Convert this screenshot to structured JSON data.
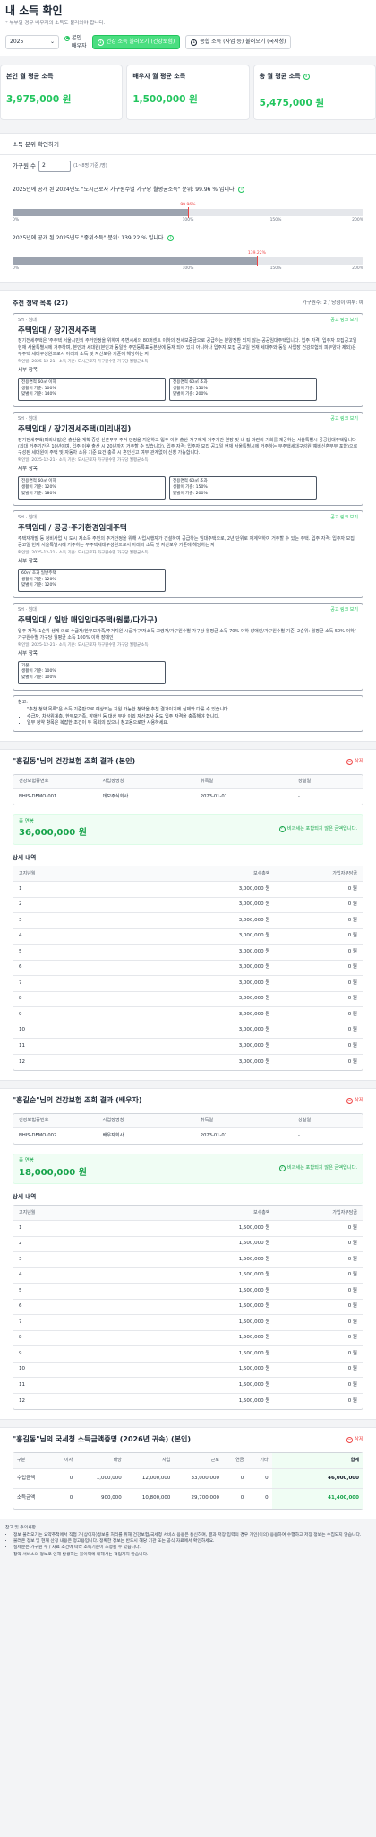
{
  "header": {
    "title": "내 소득 확인",
    "note": "* 부부일 경우 배우자의 소득도 불러와야 합니다.",
    "year_select": "2025",
    "radio_options": [
      "본인",
      "배우자"
    ],
    "btn_health": "건강 소득 불러오기 (건강보험)",
    "btn_tax": "종합 소득 (사업 등) 불러오기 (국세청)"
  },
  "summary": {
    "self_title": "본인 월 평균 소득",
    "self_value": "3,975,000 원",
    "spouse_title": "배우자 월 평균 소득",
    "spouse_value": "1,500,000 원",
    "total_title": "총 월 평균 소득",
    "total_value": "5,475,000 원"
  },
  "rank": {
    "section_title": "소득 분위 확인하기",
    "household_label": "가구원 수",
    "household_value": "2",
    "household_hint": "(1~8명 기준 /명)",
    "bar1_label": "2025년에 공개 된 2024년도 \"도시근로자 가구원수별 가구당 월평균소득\" 분위: 99.96 % 입니다.",
    "bar1_marker": "99.96%",
    "bar1_percent": 99.96,
    "bar2_label": "2025년에 공개 된 2025년도 \"중위소득\" 분위: 139.22 % 입니다.",
    "bar2_marker": "139.22%",
    "bar2_percent": 139.22,
    "ticks": [
      "0%",
      "100%",
      "150%",
      "200%"
    ]
  },
  "recommend": {
    "title": "추천 청약 목록 (27)",
    "meta": "가구원수: 2 / 당첨이 여부: 예",
    "link": "공고 링크 보기",
    "sub_label": "세부 항목",
    "items": [
      {
        "org": "SH · 임대",
        "name": "주택임대 / 장기전세주택",
        "desc": "장기전세주택은 '주주택 서울시민의 주거안정을 위하여 주변시세의 80퍼센트 이하의 전세보증금으로 공급하는 분양전환 되지 않는 공공임대주택입니다. 입주 자격: 입주자 모집공고일 현재 서울특별시에 거주하며, 본인과 세대원(본인과 동일한 주민등록표등본상에 등재 되어 있지 아니하나 입주자 모집 공고일 현재 세대주와 동일 사업장 건강보험의 피부양자 제외)은 무주택 세대구성원으로서 아래의 소득 및 자산보유 기준에 해당하는 자",
        "date": "확인일: 2025-12-21 · 소득 기준: 도시근로자 가구원수별 가구당 월평균소득",
        "criteria": [
          [
            "전용면적 60㎡ 이하",
            "생활이 기준: 100%",
            "맞벌이 기준: 140%"
          ],
          [
            "전용면적 60㎡ 초과",
            "생활이 기준: 150%",
            "맞벌이 기준: 200%"
          ]
        ]
      },
      {
        "org": "SH · 임대",
        "name": "주택임대 / 장기전세주택(미리내집)",
        "desc": "장기전세주택(미리내집)은 출산을 계획 중인 신혼부부 주거 안정을 지원하고 입주 이후 출산 가구에게 거주기간 연장 및 내 집 마련의 기회를 제공하는 서울특별시 공공임대주택입니다(최대 거주기간은 10년이며, 입주 이후 출산 시 20년까지 거주할 수 있습니다). 입주 자격: 입주자 모집 공고일 현재 서울특별시에 거주하는 무주택세대구성원(예비신혼부부 포함)으로 구성된 세대원이 주택 및 자동차 소유 기준 요건 충족 시 혼인신고 여부 관계없이 신청 가능합니다.",
        "date": "확인일: 2025-12-21 · 소득 기준: 도시근로자 가구원수별 가구당 월평균소득",
        "criteria": [
          [
            "전용면적 60㎡ 이하",
            "생활이 기준: 120%",
            "맞벌이 기준: 180%"
          ],
          [
            "전용면적 60㎡ 초과",
            "생활이 기준: 150%",
            "맞벌이 기준: 200%"
          ]
        ]
      },
      {
        "org": "SH · 임대",
        "name": "주택임대 / 공공·주거환경임대주택",
        "desc": "주택재개발 등 정비사업 시 도시 저소득 주민의 주거안정을 위해 사업시행자가 건설하여 공급하는 임대주택으로, 2년 단위로 재계약하여 거주할 수 있는 주택. 입주 자격: 입주자 모집공고일 현재 서울특별시에 거주하는 무주택세대구성원으로서 아래의 소득 및 자산보유 기준에 해당하는 자",
        "date": "확인일: 2025-12-21 · 소득 기준: 도시근로자 가구원수별 가구당 월평균소득",
        "criteria": [
          [
            "60㎡ 초과 일반주택",
            "생활이 기준: 120%",
            "맞벌이 기준: 120%"
          ]
        ]
      },
      {
        "org": "SH · 임대",
        "name": "주택임대 / 일반 매입임대주택(원룸/다가구)",
        "desc": "입주 자격: 1순위 생계·의료 수급자/한부모가족/주거지원 시급가구/저소득 고령자/가구원수별 가구당 월평균 소득 70% 이하 장애인/가구원수별 기준, 2순위: 월평균 소득 50% 이하/가구원수별 가구당 월평균 소득 100% 이하 장애인",
        "date": "확인일: 2025-12-21 · 소득 기준: 도시근로자 가구원수별 가구당 월평균소득",
        "criteria": [
          [
            "기본",
            "생활이 기준: 100%",
            "맞벌이 기준: 100%"
          ]
        ]
      }
    ],
    "note_title": "참고:",
    "notes": [
      "\"추천 청약 목록\"은 소득 기준만으로 예상되는 지원 가능한 청약을 추천 결과이기에 실제와 다를 수 있습니다.",
      "수급자, 차상위계층, 한부모가족, 장애인 등 대상 무관 이외 자산조사 등도 입주 자격을 충족해야 합니다.",
      "일부 청약 항목은 복잡한 조건이 두 목회의 있으니 청고용으로만 사용하세요."
    ]
  },
  "health": [
    {
      "title": "\"홍길동\"님의 건강보험 조회 결과 (본인)",
      "delete": "삭제",
      "headers": [
        "건강보험증번호",
        "사업장명칭",
        "취득일",
        "상실일"
      ],
      "row": [
        "NHIS-DEMO-001",
        "데모주식회사",
        "2023-01-01",
        "-"
      ],
      "total_label": "총 연봉",
      "total_value": "36,000,000 원",
      "badge": "비과세는 포함되지 않은 금액입니다.",
      "detail_title": "상세 내역",
      "col_month": "고지년월",
      "col_premium": "보수총액",
      "col_extra": "가입자부담금",
      "months": [
        "1",
        "2",
        "3",
        "4",
        "5",
        "6",
        "7",
        "8",
        "9",
        "10",
        "11",
        "12"
      ],
      "amount": "3,000,000 원",
      "extra": "0 원"
    },
    {
      "title": "\"홍길순\"님의 건강보험 조회 결과 (배우자)",
      "delete": "삭제",
      "headers": [
        "건강보험증번호",
        "사업장명칭",
        "취득일",
        "상실일"
      ],
      "row": [
        "NHIS-DEMO-002",
        "배우자회사",
        "2023-01-01",
        "-"
      ],
      "total_label": "총 연봉",
      "total_value": "18,000,000 원",
      "badge": "비과세는 포함되지 않은 금액입니다.",
      "detail_title": "상세 내역",
      "col_month": "고지년월",
      "col_premium": "보수총액",
      "col_extra": "가입자부담금",
      "months": [
        "1",
        "2",
        "3",
        "4",
        "5",
        "6",
        "7",
        "8",
        "9",
        "10",
        "11",
        "12"
      ],
      "amount": "1,500,000 원",
      "extra": "0 원"
    }
  ],
  "tax": {
    "title": "\"홍길동\"님의 국세청 소득금액증명 (2026년 귀속) (본인)",
    "delete": "삭제",
    "headers": [
      "구분",
      "이자",
      "배당",
      "사업",
      "근로",
      "연금",
      "기타",
      "합계"
    ],
    "rows": [
      [
        "수입금액",
        "0",
        "1,000,000",
        "12,000,000",
        "33,000,000",
        "0",
        "0",
        "46,000,000"
      ],
      [
        "소득금액",
        "0",
        "900,000",
        "10,800,000",
        "29,700,000",
        "0",
        "0",
        "41,400,000"
      ]
    ]
  },
  "footnotes": {
    "title": "참고 및 주의사항",
    "items": [
      "정보 불러오기는 요약추적에서 직접 가(상이자)정보를 처리를 위해 건강보험/국세청 서비스 응용은 통신하며, 결과 저장 입력의 경우 개인(이의) 응용하여 수행하고 저장 정보는 수집되지 않습니다.",
      "불러온 정보 및 현재 산정 내용은 정고용입니다. 정확한 정보는 반드시 해당 기관 또는 공식 자료에서 확인하세요.",
      "실제분은 가구원 수 / 자료 조건에 따라 소득기준이 조정될 수 있습니다.",
      "청약 서비스의 정보로 인해 발생하는 불이익에 대해서는 책임지지 않습니다."
    ]
  }
}
